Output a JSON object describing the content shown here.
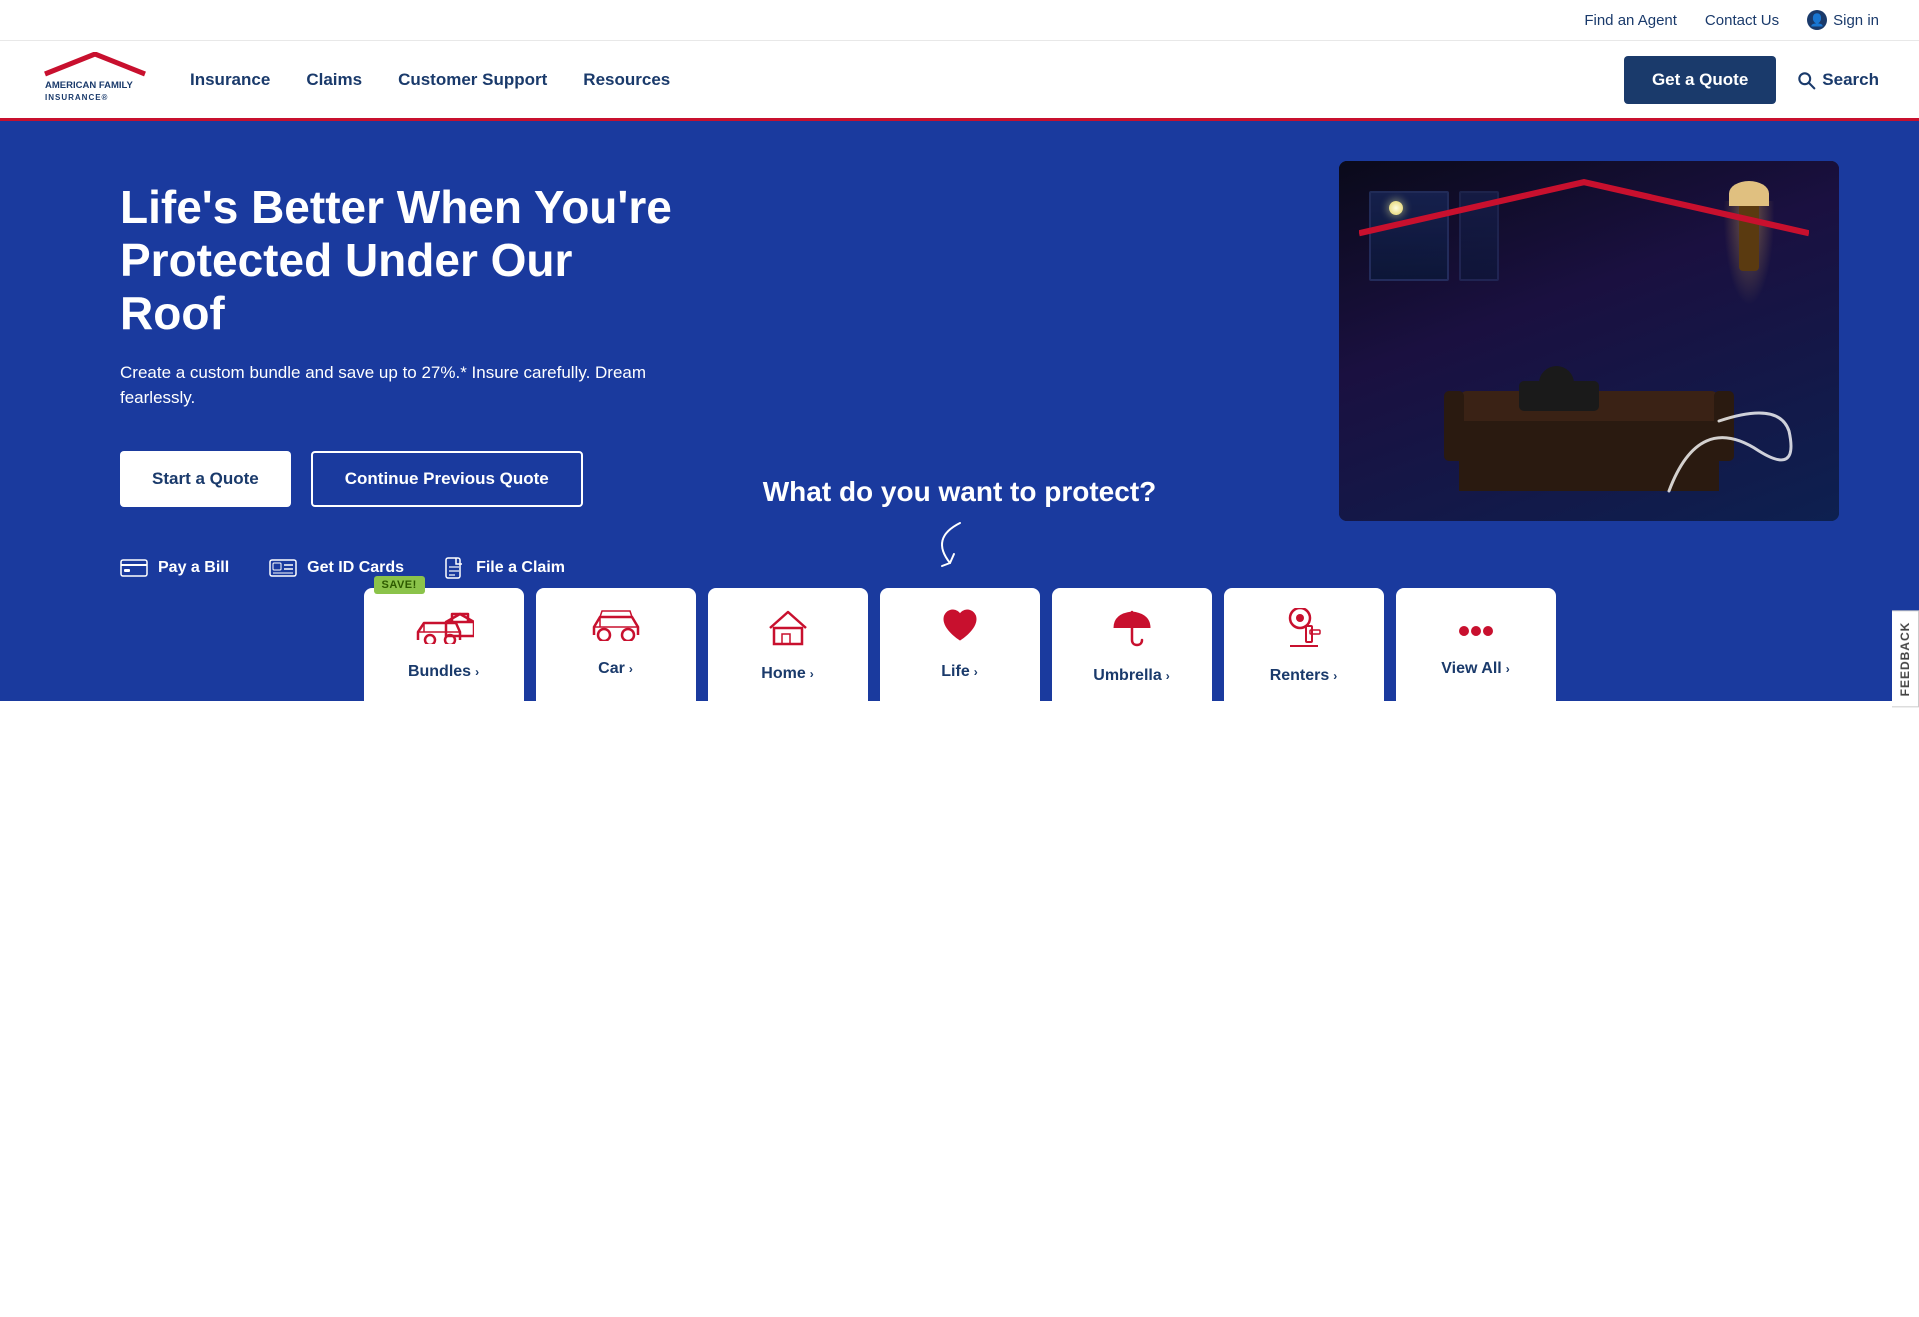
{
  "topbar": {
    "find_agent": "Find an Agent",
    "contact_us": "Contact Us",
    "sign_in": "Sign in"
  },
  "nav": {
    "logo_line1": "AMERICAN FAMILY",
    "logo_line2": "INSURANCE",
    "insurance": "Insurance",
    "claims": "Claims",
    "customer_support": "Customer Support",
    "resources": "Resources",
    "get_quote": "Get a Quote",
    "search": "Search"
  },
  "hero": {
    "title": "Life's Better When You're Protected Under Our Roof",
    "subtitle": "Create a custom bundle and save up to 27%.* Insure carefully. Dream fearlessly.",
    "start_quote": "Start a Quote",
    "continue_quote": "Continue Previous Quote",
    "pay_bill": "Pay a Bill",
    "get_id_cards": "Get ID Cards",
    "file_claim": "File a Claim"
  },
  "protect": {
    "title": "What do you want to protect?"
  },
  "products": [
    {
      "label": "Bundles",
      "icon": "🚗🏠",
      "save": true
    },
    {
      "label": "Car",
      "icon": "🚗",
      "save": false
    },
    {
      "label": "Home",
      "icon": "🏠",
      "save": false
    },
    {
      "label": "Life",
      "icon": "❤️",
      "save": false
    },
    {
      "label": "Umbrella",
      "icon": "🛡️",
      "save": false
    },
    {
      "label": "Renters",
      "icon": "🔑",
      "save": false
    },
    {
      "label": "View All",
      "icon": "•••",
      "save": false
    }
  ],
  "feedback": {
    "label": "FEEDBACK"
  }
}
